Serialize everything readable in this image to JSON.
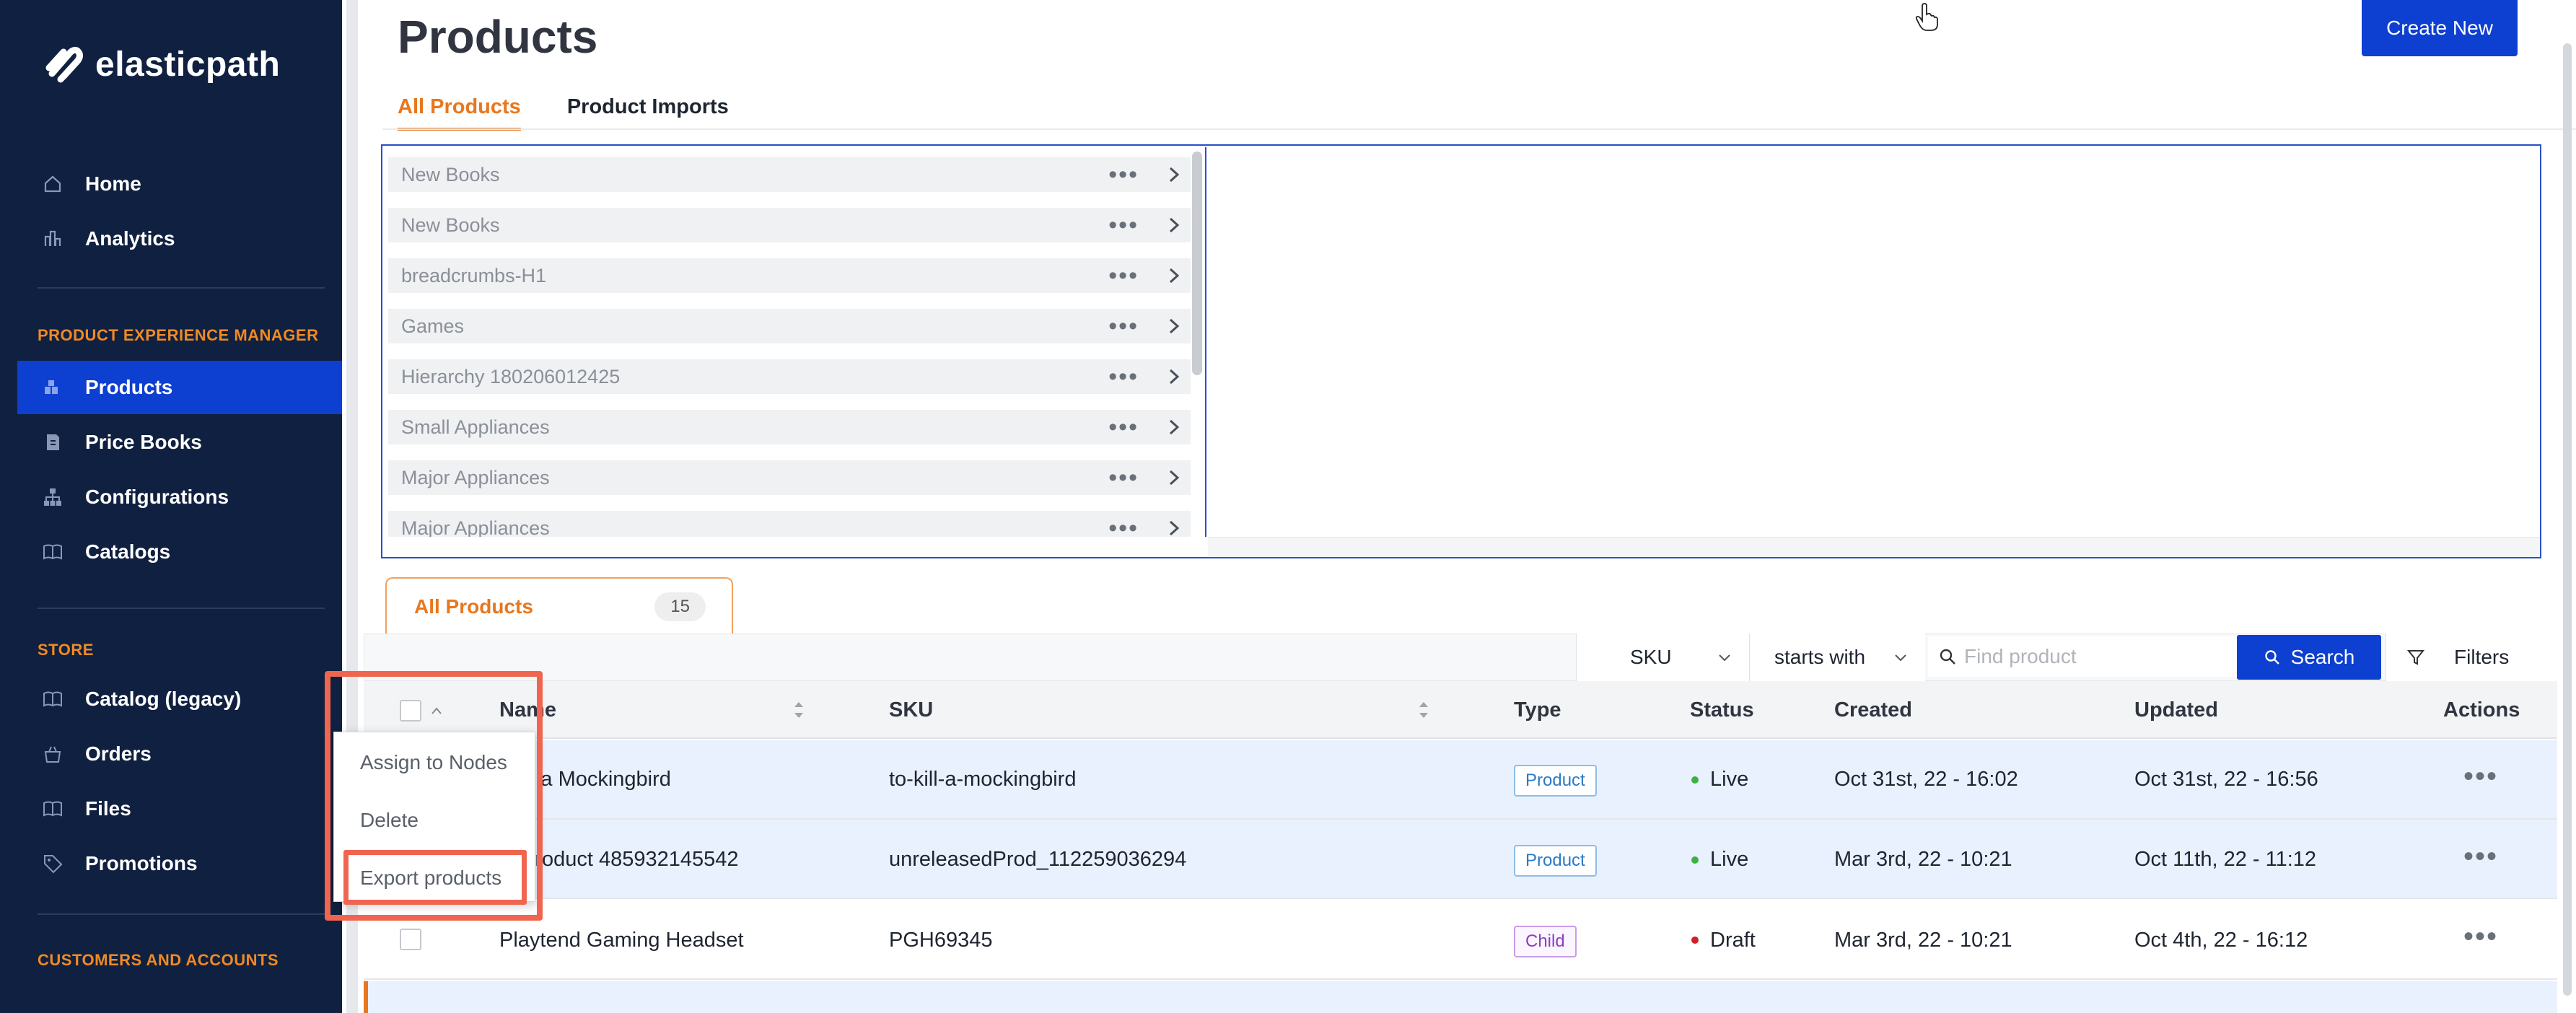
{
  "brand": {
    "name": "elasticpath"
  },
  "sidebar": {
    "main_items": [
      {
        "label": "Home",
        "icon": "home-icon"
      },
      {
        "label": "Analytics",
        "icon": "analytics-icon"
      }
    ],
    "pxm_title": "PRODUCT EXPERIENCE MANAGER",
    "pxm_items": [
      {
        "label": "Products",
        "icon": "products-icon",
        "active": true
      },
      {
        "label": "Price Books",
        "icon": "price-book-icon"
      },
      {
        "label": "Configurations",
        "icon": "configurations-icon"
      },
      {
        "label": "Catalogs",
        "icon": "catalog-icon"
      }
    ],
    "store_title": "STORE",
    "store_items": [
      {
        "label": "Catalog (legacy)",
        "icon": "catalog-icon"
      },
      {
        "label": "Orders",
        "icon": "orders-icon"
      },
      {
        "label": "Files",
        "icon": "files-icon"
      },
      {
        "label": "Promotions",
        "icon": "tag-icon"
      }
    ],
    "customers_title": "CUSTOMERS AND ACCOUNTS"
  },
  "page": {
    "title": "Products",
    "create_label": "Create New",
    "tabs": [
      "All Products",
      "Product Imports"
    ]
  },
  "tree": {
    "nodes": [
      "New Books",
      "New Books",
      "breadcrumbs-H1",
      "Games",
      "Hierarchy 180206012425",
      "Small Appliances",
      "Major Appliances",
      "Major Appliances"
    ]
  },
  "list": {
    "tab_label": "All Products",
    "count": "15"
  },
  "filter": {
    "field": "SKU",
    "operator": "starts with",
    "placeholder": "Find product",
    "search_label": "Search",
    "filters_label": "Filters"
  },
  "table": {
    "headers": {
      "name": "Name",
      "sku": "SKU",
      "type": "Type",
      "status": "Status",
      "created": "Created",
      "updated": "Updated",
      "actions": "Actions"
    },
    "rows": [
      {
        "name": "ill a Mockingbird",
        "sku": "to-kill-a-mockingbird",
        "type": "Product",
        "status": "Live",
        "created": "Oct 31st, 22 - 16:02",
        "updated": "Oct 31st, 22 - 16:56"
      },
      {
        "name": "Product 485932145542",
        "sku": "unreleasedProd_112259036294",
        "type": "Product",
        "status": "Live",
        "created": "Mar 3rd, 22 - 10:21",
        "updated": "Oct 11th, 22 - 11:12"
      },
      {
        "name": "Playtend Gaming Headset",
        "sku": "PGH69345",
        "type": "Child",
        "status": "Draft",
        "created": "Mar 3rd, 22 - 10:21",
        "updated": "Oct 4th, 22 - 16:12"
      }
    ]
  },
  "context_menu": {
    "items": [
      "Assign to Nodes",
      "Delete",
      "Export products"
    ]
  },
  "colors": {
    "sidebar_bg": "#102040",
    "accent_blue": "#0d3fd0",
    "accent_orange": "#e8771e",
    "live": "#3cb043",
    "draft": "#d0202a",
    "highlight": "#f06550"
  }
}
